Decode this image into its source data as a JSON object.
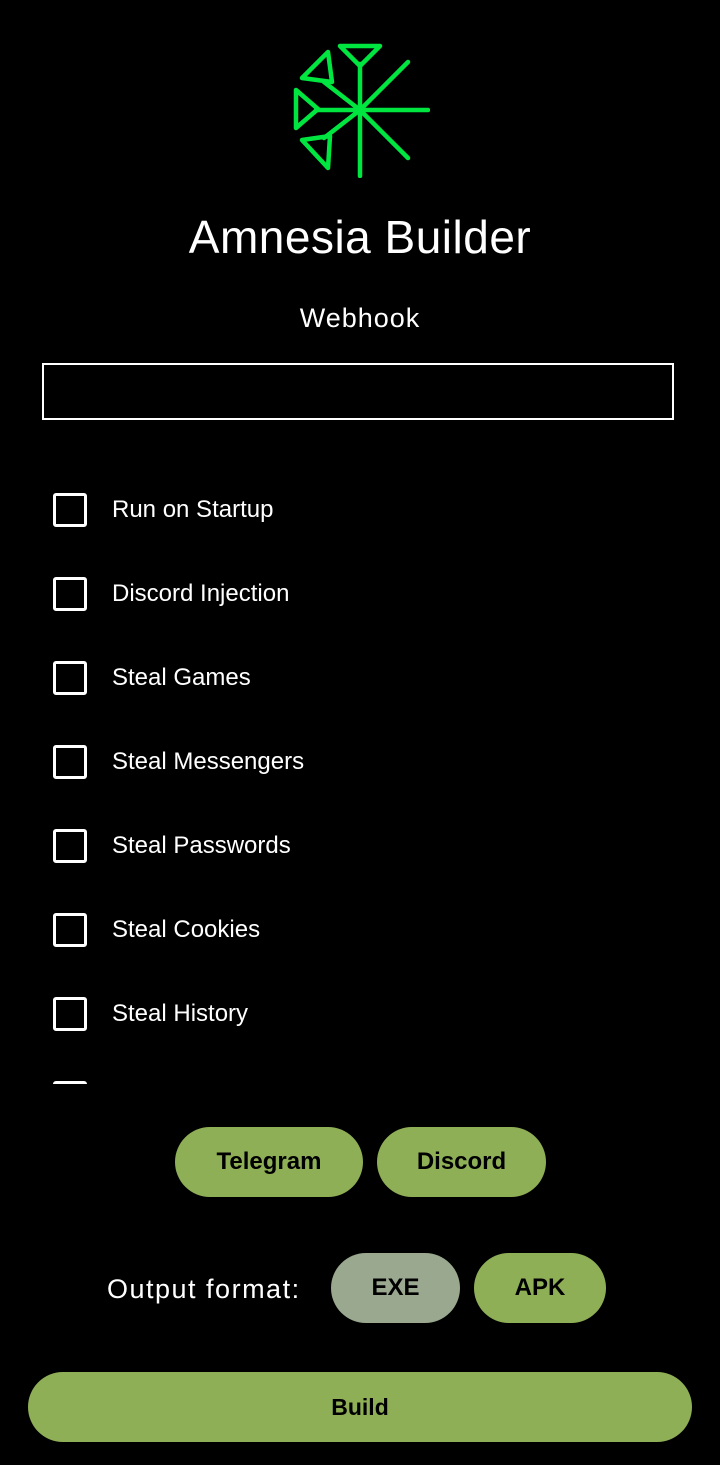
{
  "app": {
    "title": "Amnesia Builder",
    "logo_icon": "amnesia-logo-icon",
    "accent_color": "#00e640"
  },
  "webhook": {
    "label": "Webhook",
    "value": "",
    "placeholder": ""
  },
  "options": [
    {
      "label": "Run on Startup",
      "checked": false
    },
    {
      "label": "Discord Injection",
      "checked": false
    },
    {
      "label": "Steal Games",
      "checked": false
    },
    {
      "label": "Steal Messengers",
      "checked": false
    },
    {
      "label": "Steal Passwords",
      "checked": false
    },
    {
      "label": "Steal Cookies",
      "checked": false
    },
    {
      "label": "Steal History",
      "checked": false
    },
    {
      "label": "",
      "checked": false
    }
  ],
  "platform_buttons": {
    "telegram": "Telegram",
    "discord": "Discord"
  },
  "output": {
    "label": "Output format:",
    "exe": "EXE",
    "apk": "APK",
    "selected": "EXE"
  },
  "build_label": "Build",
  "colors": {
    "button": "#8faf57",
    "button_selected": "#9aa88f",
    "background": "#000000",
    "text": "#ffffff"
  }
}
